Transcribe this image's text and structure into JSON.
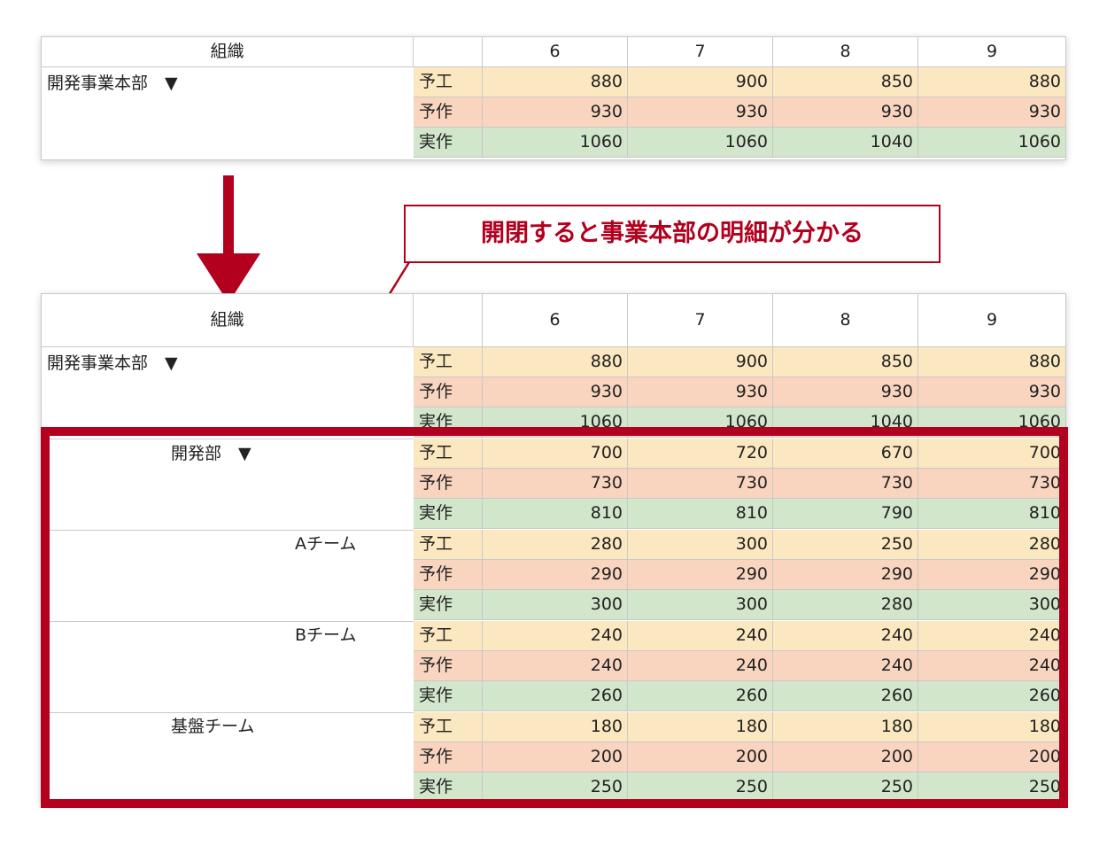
{
  "header": {
    "org": "組織",
    "months": [
      "6",
      "7",
      "8",
      "9"
    ]
  },
  "labels": {
    "yoko": "予工",
    "yosa": "予作",
    "jisa": "実作"
  },
  "callout_text": "開閉すると事業本部の明細が分かる",
  "accent_color": "#b3001e",
  "row_colors": {
    "yoko": "#fce8c0",
    "yosa": "#f9d5c0",
    "jisa": "#d2e6cc"
  },
  "table_collapsed": {
    "org": "開発事業本部　▼",
    "rows": [
      {
        "label": "予工",
        "values": [
          "880",
          "900",
          "850",
          "880"
        ]
      },
      {
        "label": "予作",
        "values": [
          "930",
          "930",
          "930",
          "930"
        ]
      },
      {
        "label": "実作",
        "values": [
          "1060",
          "1060",
          "1040",
          "1060"
        ]
      }
    ]
  },
  "table_expanded": {
    "groups": [
      {
        "org": "開発事業本部　▼",
        "rows": [
          {
            "label": "予工",
            "values": [
              "880",
              "900",
              "850",
              "880"
            ]
          },
          {
            "label": "予作",
            "values": [
              "930",
              "930",
              "930",
              "930"
            ]
          },
          {
            "label": "実作",
            "values": [
              "1060",
              "1060",
              "1040",
              "1060"
            ]
          }
        ]
      },
      {
        "org": "開発部　▼",
        "rows": [
          {
            "label": "予工",
            "values": [
              "700",
              "720",
              "670",
              "700"
            ]
          },
          {
            "label": "予作",
            "values": [
              "730",
              "730",
              "730",
              "730"
            ]
          },
          {
            "label": "実作",
            "values": [
              "810",
              "810",
              "790",
              "810"
            ]
          }
        ]
      },
      {
        "org": "Aチーム",
        "rows": [
          {
            "label": "予工",
            "values": [
              "280",
              "300",
              "250",
              "280"
            ]
          },
          {
            "label": "予作",
            "values": [
              "290",
              "290",
              "290",
              "290"
            ]
          },
          {
            "label": "実作",
            "values": [
              "300",
              "300",
              "280",
              "300"
            ]
          }
        ]
      },
      {
        "org": "Bチーム",
        "rows": [
          {
            "label": "予工",
            "values": [
              "240",
              "240",
              "240",
              "240"
            ]
          },
          {
            "label": "予作",
            "values": [
              "240",
              "240",
              "240",
              "240"
            ]
          },
          {
            "label": "実作",
            "values": [
              "260",
              "260",
              "260",
              "260"
            ]
          }
        ]
      },
      {
        "org": "基盤チーム",
        "rows": [
          {
            "label": "予工",
            "values": [
              "180",
              "180",
              "180",
              "180"
            ]
          },
          {
            "label": "予作",
            "values": [
              "200",
              "200",
              "200",
              "200"
            ]
          },
          {
            "label": "実作",
            "values": [
              "250",
              "250",
              "250",
              "250"
            ]
          }
        ]
      }
    ]
  }
}
